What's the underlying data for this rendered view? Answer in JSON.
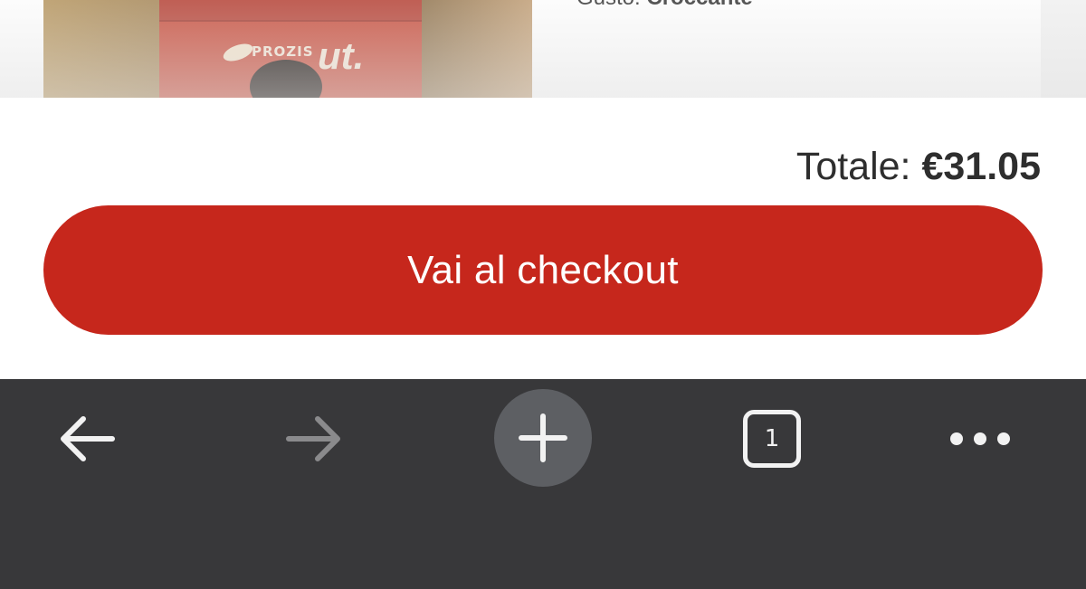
{
  "product": {
    "image_brand_text": "PROZIS",
    "flavor_label": "Gusto:",
    "flavor_value": "Croccante"
  },
  "checkout": {
    "total_label": "Totale:",
    "total_amount": "€31.05",
    "button_label": "Vai al checkout",
    "accent_color": "#c6271c"
  },
  "browser_toolbar": {
    "background_color": "#38383a",
    "buttons": [
      {
        "name": "back",
        "icon": "arrow-left-icon",
        "enabled": true
      },
      {
        "name": "forward",
        "icon": "arrow-right-icon",
        "enabled": false
      },
      {
        "name": "new-tab",
        "icon": "plus-icon",
        "enabled": true
      },
      {
        "name": "tabs",
        "icon": "tab-switcher-icon",
        "enabled": true
      },
      {
        "name": "menu",
        "icon": "more-dots-icon",
        "enabled": true
      }
    ],
    "tab_count": "1"
  }
}
